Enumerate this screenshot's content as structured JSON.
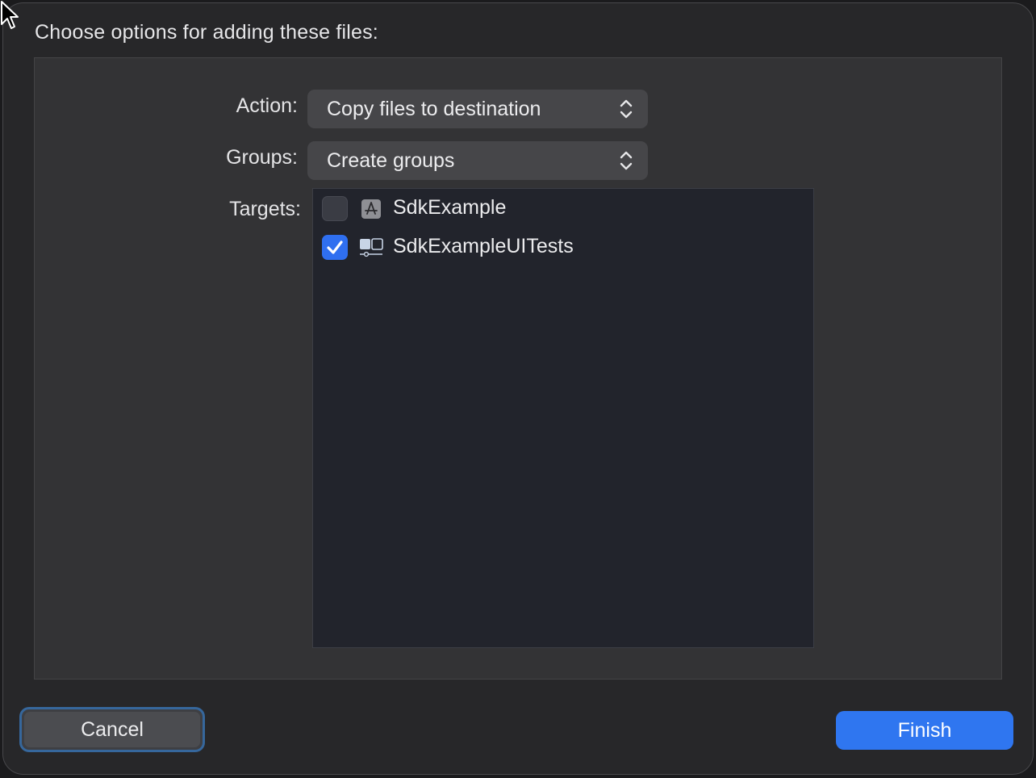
{
  "dialog": {
    "heading": "Choose options for adding these files:"
  },
  "options": {
    "action": {
      "label": "Action:",
      "value": "Copy files to destination"
    },
    "groups": {
      "label": "Groups:",
      "value": "Create groups"
    },
    "targets": {
      "label": "Targets:",
      "items": [
        {
          "name": "SdkExample",
          "checked": false,
          "icon": "app-target-icon"
        },
        {
          "name": "SdkExampleUITests",
          "checked": true,
          "icon": "ui-test-target-icon"
        }
      ]
    }
  },
  "buttons": {
    "cancel": "Cancel",
    "finish": "Finish"
  },
  "colors": {
    "accent": "#2f76f0",
    "focus_ring": "#36679c"
  }
}
